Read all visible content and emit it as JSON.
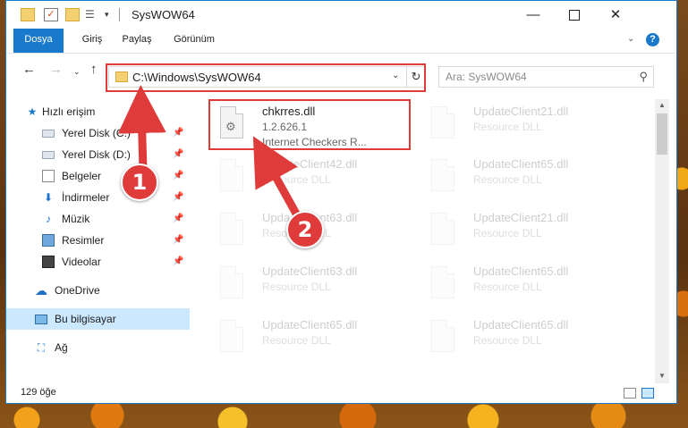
{
  "window": {
    "title": "SysWOW64",
    "minimize_glyph": "—",
    "close_glyph": "✕"
  },
  "quick_access_toolbar": {
    "check_glyph": "✓",
    "props_glyph": "☰",
    "dropdown_glyph": "▾"
  },
  "ribbon": {
    "tabs": [
      "Dosya",
      "Giriş",
      "Paylaş",
      "Görünüm"
    ],
    "expand_glyph": "⌄",
    "help_glyph": "?"
  },
  "navigation": {
    "back_glyph": "←",
    "forward_glyph": "→",
    "recent_glyph": "⌄",
    "up_glyph": "↑",
    "address": "C:\\Windows\\SysWOW64",
    "address_dropdown_glyph": "⌄",
    "refresh_glyph": "↻",
    "search_placeholder": "Ara: SysWOW64",
    "search_glyph": "⚲"
  },
  "sidebar": {
    "pin_glyph": "📌",
    "items": [
      {
        "label": "Hızlı erişim",
        "icon": "star-icon",
        "glyph": "★"
      },
      {
        "label": "Yerel Disk (C:)",
        "icon": "drive-icon"
      },
      {
        "label": "Yerel Disk (D:)",
        "icon": "drive-icon"
      },
      {
        "label": "Belgeler",
        "icon": "documents-icon"
      },
      {
        "label": "İndirmeler",
        "icon": "downloads-icon",
        "glyph": "⬇"
      },
      {
        "label": "Müzik",
        "icon": "music-icon",
        "glyph": "♪"
      },
      {
        "label": "Resimler",
        "icon": "pictures-icon"
      },
      {
        "label": "Videolar",
        "icon": "videos-icon"
      },
      {
        "label": "OneDrive",
        "icon": "cloud-icon",
        "glyph": "☁"
      },
      {
        "label": "Bu bilgisayar",
        "icon": "computer-icon",
        "selected": true
      },
      {
        "label": "Ağ",
        "icon": "network-icon",
        "glyph": "⛶"
      }
    ]
  },
  "files": {
    "gear_glyph": "⚙",
    "items": [
      {
        "name": "chkrres.dll",
        "version": "1.2.626.1",
        "description": "Internet Checkers R...",
        "faded": false
      },
      {
        "name": "UpdateClient21.dll",
        "description": "Resource DLL",
        "faded": true
      },
      {
        "name": "UpdateClient42.dll",
        "description": "Resource DLL",
        "faded": true
      },
      {
        "name": "UpdateClient65.dll",
        "description": "Resource DLL",
        "faded": true
      },
      {
        "name": "UpdateClient63.dll",
        "description": "Resource DLL",
        "faded": true
      },
      {
        "name": "UpdateClient21.dll",
        "description": "Resource DLL",
        "faded": true
      },
      {
        "name": "UpdateClient63.dll",
        "description": "Resource DLL",
        "faded": true
      },
      {
        "name": "UpdateClient65.dll",
        "description": "Resource DLL",
        "faded": true
      },
      {
        "name": "UpdateClient65.dll",
        "description": "Resource DLL",
        "faded": true
      },
      {
        "name": "UpdateClient65.dll",
        "description": "Resource DLL",
        "faded": true
      }
    ]
  },
  "scrollbar": {
    "up_glyph": "▲",
    "down_glyph": "▼"
  },
  "status": {
    "item_count": "129 öğe"
  },
  "annotations": {
    "step1": "1",
    "step2": "2",
    "color": "#e03b3b"
  },
  "colors": {
    "accent": "#1979ca",
    "selection": "#cce8ff"
  }
}
